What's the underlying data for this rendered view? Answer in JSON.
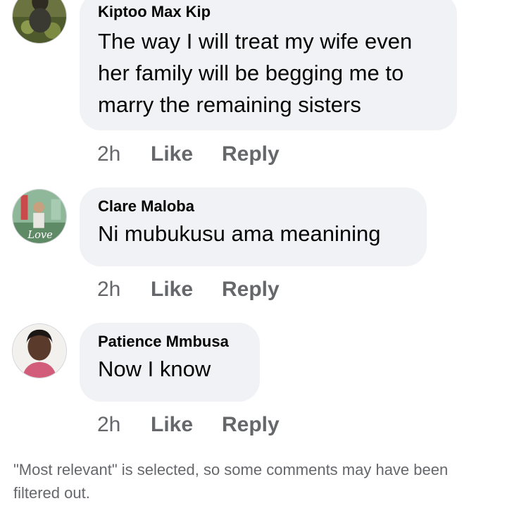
{
  "comments": [
    {
      "author": "Kiptoo Max Kip",
      "text": "The way I will treat my wife even her family will be begging me to marry the remaining sisters",
      "time": "2h",
      "like_label": "Like",
      "reply_label": "Reply"
    },
    {
      "author": "Clare Maloba",
      "text": "Ni mubukusu ama meanining",
      "time": "2h",
      "like_label": "Like",
      "reply_label": "Reply",
      "avatar_text": "Love"
    },
    {
      "author": "Patience Mmbusa",
      "text": "Now I know",
      "time": "2h",
      "like_label": "Like",
      "reply_label": "Reply"
    }
  ],
  "footer_notice": "\"Most relevant\" is selected, so some comments may have been filtered out."
}
